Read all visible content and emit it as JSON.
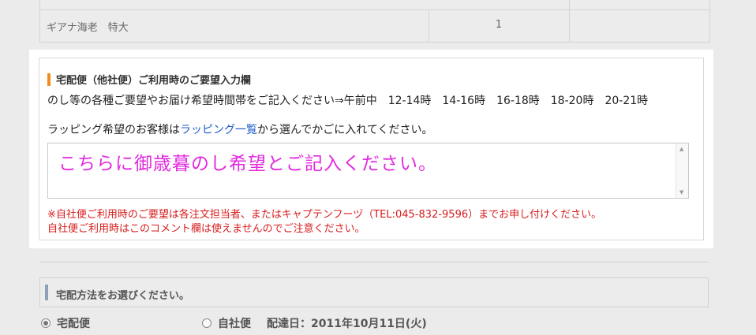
{
  "order_table": {
    "item_name": "ギアナ海老　特大",
    "quantity": "1"
  },
  "request_panel": {
    "title": "宅配便（他社便）ご利用時のご要望入力欄",
    "description": "のし等の各種ご要望やお届け希望時間帯をご記入ください⇒午前中　12-14時　14-16時　16-18時　18-20時　20-21時",
    "wrapping_prefix": "ラッピング希望のお客様は",
    "wrapping_link": "ラッピング一覧",
    "wrapping_suffix": "から選んでかごに入れてください。",
    "comment_value": "こちらに御歳暮のし希望とご記入ください。",
    "note_line1": "※自社便ご利用時のご要望は各注文担当者、またはキャプテンフーヅ（TEL:045-832-9596）までお申し付けください。",
    "note_line2": "自社便ご利用時はこのコメント欄は使えませんのでご注意ください。",
    "accent_color": "#f08c1e",
    "comment_text_color": "#e22adf",
    "note_color": "#d71c1c"
  },
  "shipping": {
    "title": "宅配方法をお選びください。",
    "options": [
      {
        "label": "宅配便",
        "selected": true
      },
      {
        "label": "自社便",
        "selected": false
      }
    ],
    "delivery_date": "配達日：2011年10月11日(火)"
  }
}
